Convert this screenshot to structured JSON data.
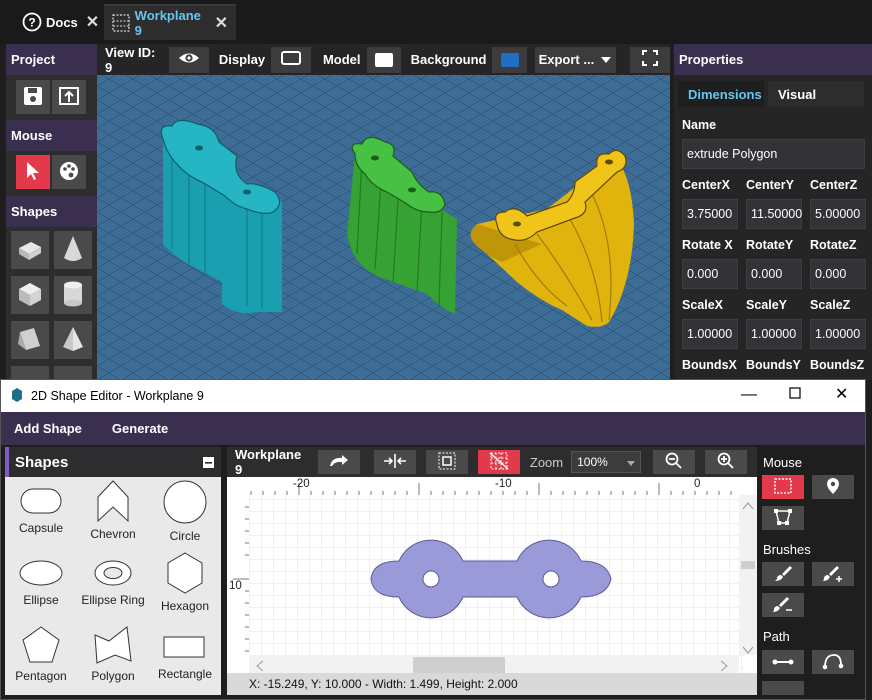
{
  "tabs": [
    {
      "label": "Docs",
      "icon": "question-circle-icon"
    },
    {
      "label": "Workplane 9",
      "icon": "grid-icon"
    }
  ],
  "left_panel": {
    "sections": {
      "project": "Project",
      "mouse": "Mouse",
      "shapes": "Shapes"
    }
  },
  "viewbar": {
    "view_id": "View ID: 9",
    "display": "Display",
    "model": "Model",
    "background": "Background",
    "export": "Export ...",
    "background_color": "#1e6fc4"
  },
  "properties": {
    "title": "Properties",
    "tabs": [
      "Dimensions",
      "Visual"
    ],
    "name_label": "Name",
    "name_value": "extrude Polygon",
    "center_labels": [
      "CenterX",
      "CenterY",
      "CenterZ"
    ],
    "center_values": [
      "3.75000",
      "11.50000",
      "5.00000"
    ],
    "rotate_labels": [
      "Rotate X",
      "RotateY",
      "RotateZ"
    ],
    "rotate_values": [
      "0.000",
      "0.000",
      "0.000"
    ],
    "scale_labels": [
      "ScaleX",
      "ScaleY",
      "ScaleZ"
    ],
    "scale_values": [
      "1.00000",
      "1.00000",
      "1.00000"
    ],
    "bounds_labels": [
      "BoundsX",
      "BoundsY",
      "BoundsZ"
    ]
  },
  "dialog": {
    "title": "2D Shape Editor - Workplane 9",
    "menu": [
      "Add Shape",
      "Generate"
    ],
    "shapes_title": "Shapes",
    "shape_items": [
      "Capsule",
      "Chevron",
      "Circle",
      "Ellipse",
      "Ellipse Ring",
      "Hexagon",
      "Pentagon",
      "Polygon",
      "Rectangle"
    ],
    "toolbar": {
      "workplane": "Workplane 9",
      "zoom_label": "Zoom",
      "zoom_value": "100%"
    },
    "ruler": {
      "top": [
        "-20",
        "-10",
        "0"
      ],
      "left": [
        "10"
      ]
    },
    "status": "X: -15.249, Y: 10.000 - Width: 1.499, Height: 2.000",
    "right": {
      "mouse": "Mouse",
      "brushes": "Brushes",
      "path": "Path"
    }
  },
  "colors": {
    "accent_red": "#e23a4a",
    "purple_header": "#3a2f4f",
    "shape_fill": "#9a9ad8",
    "teal": "#1fa7b5",
    "green": "#3fae3a",
    "gold": "#e3b40e"
  }
}
